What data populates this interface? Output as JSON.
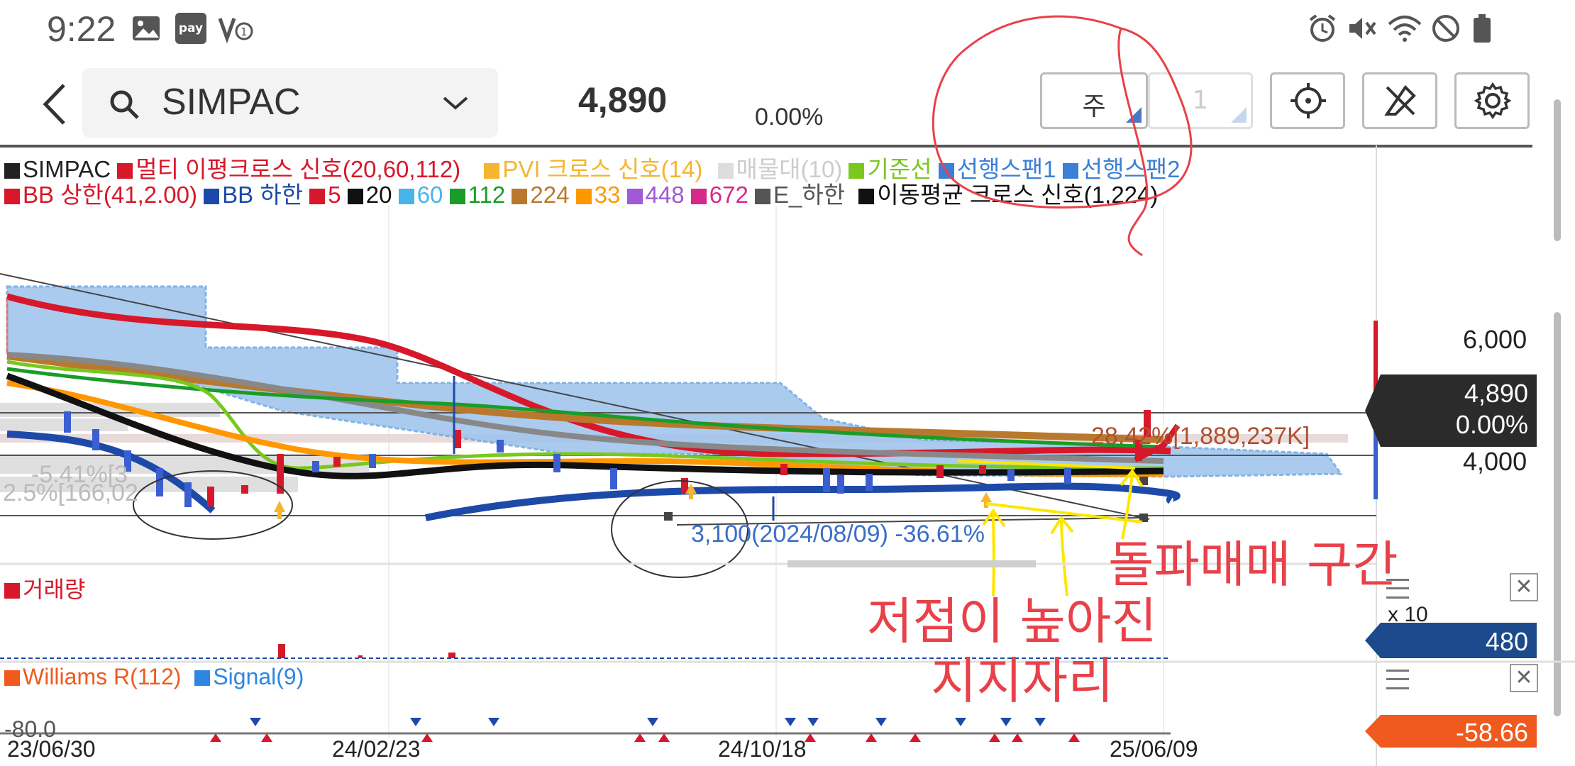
{
  "status_bar": {
    "time": "9:22",
    "icons": [
      "image-icon",
      "pay-icon",
      "volte-icon",
      "alarm-icon",
      "mute-icon",
      "wifi-icon",
      "do-not-disturb-icon",
      "battery-icon"
    ],
    "pay_label": "pay"
  },
  "header": {
    "symbol": "SIMPAC",
    "price": "4,890",
    "change": "0.00%",
    "period_button": "주",
    "period_count": "1"
  },
  "legend": {
    "row1": [
      {
        "label": "SIMPAC",
        "color": "#222222"
      },
      {
        "label": "멀티 이평크로스 신호(20,60,112)",
        "color": "#d7182a"
      },
      {
        "label": "PVI 크로스 신호(14)",
        "color": "#f5b52e"
      },
      {
        "label": "매물대(10)",
        "color": "#cccccc"
      },
      {
        "label": "기준선",
        "color": "#79c81e"
      },
      {
        "label": "선행스팬1",
        "color": "#3b7fd6"
      },
      {
        "label": "선행스팬2",
        "color": "#3b7fd6"
      }
    ],
    "row2": [
      {
        "label": "BB 상한(41,2.00)",
        "color": "#d7182a"
      },
      {
        "label": "BB 하한",
        "color": "#1d4aa8"
      },
      {
        "label": "5",
        "color": "#d7182a"
      },
      {
        "label": "20",
        "color": "#111111"
      },
      {
        "label": "60",
        "color": "#49b4e8"
      },
      {
        "label": "112",
        "color": "#1a9c28"
      },
      {
        "label": "224",
        "color": "#b8792e"
      },
      {
        "label": "33",
        "color": "#ff9800"
      },
      {
        "label": "448",
        "color": "#a05ad6"
      },
      {
        "label": "672",
        "color": "#d62a8a"
      },
      {
        "label": "E_하한",
        "color": "#555555"
      },
      {
        "label": "이동평균 크로스 신호(1,224)",
        "color": "#111111"
      }
    ]
  },
  "price_axis": {
    "ticks": [
      "6,000",
      "4,000"
    ],
    "current_price": "4,890",
    "current_change": "0.00%"
  },
  "chart_annotations": {
    "volume_profile_label": "28.42%[1,889,237K]",
    "low_label": "3,100(2024/08/09) -36.61%",
    "left_label_1": "-5.41%[3",
    "left_label_2": "2.5%[166,02"
  },
  "volume_panel": {
    "title": "거래량",
    "title_color": "#d7182a",
    "multiplier": "x 10",
    "value": "480"
  },
  "williams_panel": {
    "title": "Williams R(112)",
    "signal": "Signal(9)",
    "level": "-80.0",
    "value": "-58.66"
  },
  "x_axis": {
    "dates": [
      "23/06/30",
      "24/02/23",
      "24/10/18",
      "25/06/09"
    ]
  },
  "handwritten_notes": {
    "breakout": "돌파매매  구간",
    "low_rising": "저점이  높아진",
    "support": "지지자리"
  },
  "chart_data": {
    "type": "candlestick",
    "x_labels": [
      "23/06/30",
      "24/02/23",
      "24/10/18",
      "25/06/09"
    ],
    "y_ticks": [
      6000,
      4000
    ],
    "last_price": 4890,
    "period_low": 3100,
    "period_low_date": "2024/08/09",
    "period_low_change": "-36.61%"
  }
}
